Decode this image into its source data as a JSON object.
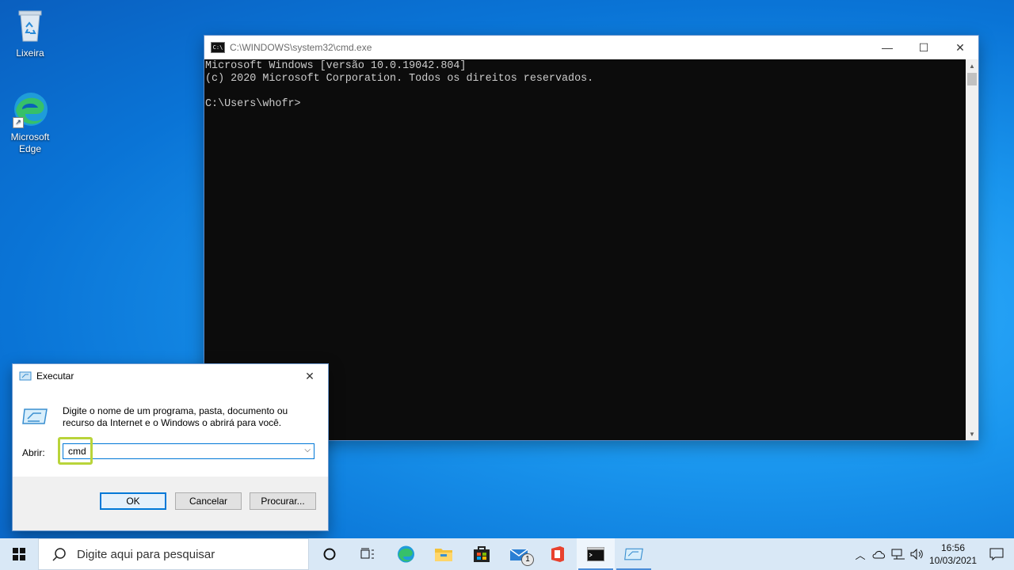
{
  "desktop": {
    "icons": [
      {
        "label": "Lixeira"
      },
      {
        "label": "Microsoft Edge"
      }
    ]
  },
  "cmd_window": {
    "title": "C:\\WINDOWS\\system32\\cmd.exe",
    "app_icon_text": "C:\\",
    "lines": [
      "Microsoft Windows [versão 10.0.19042.804]",
      "(c) 2020 Microsoft Corporation. Todos os direitos reservados.",
      "",
      "C:\\Users\\whofr>"
    ]
  },
  "run_dialog": {
    "title": "Executar",
    "description": "Digite o nome de um programa, pasta, documento ou recurso da Internet e o Windows o abrirá para você.",
    "open_label": "Abrir:",
    "input_value": "cmd",
    "ok_label": "OK",
    "cancel_label": "Cancelar",
    "browse_label": "Procurar..."
  },
  "taskbar": {
    "search_placeholder": "Digite aqui para pesquisar",
    "mail_badge": "1",
    "clock_time": "16:56",
    "clock_date": "10/03/2021"
  },
  "colors": {
    "accent": "#0078d7",
    "highlight": "#b9d43a",
    "console_bg": "#0c0c0c",
    "console_fg": "#cccccc"
  }
}
